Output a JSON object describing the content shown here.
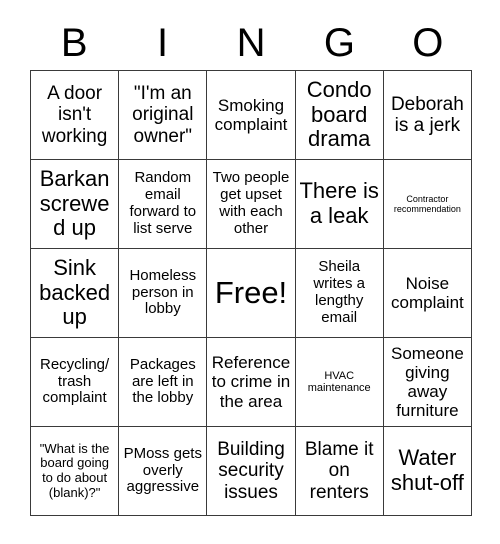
{
  "card": {
    "title": "BINGO",
    "header_letters": [
      "B",
      "I",
      "N",
      "G",
      "O"
    ],
    "free_space_index": 12,
    "colors": {
      "background": "#ffffff",
      "text": "#000000",
      "grid_line": "#3a3a3a"
    }
  },
  "grid": {
    "columns": 5,
    "rows": 5,
    "cells": [
      {
        "text": "A door isn't working",
        "size": "lg"
      },
      {
        "text": "\"I'm an original owner\"",
        "size": "lg"
      },
      {
        "text": "Smoking complaint",
        "size": "md"
      },
      {
        "text": "Condo board drama",
        "size": "xl"
      },
      {
        "text": "Deborah is a jerk",
        "size": "lg"
      },
      {
        "text": "Barkan screwed up",
        "size": "xl"
      },
      {
        "text": "Random email forward to list serve",
        "size": "sm"
      },
      {
        "text": "Two people get upset with each other",
        "size": "sm"
      },
      {
        "text": "There is a leak",
        "size": "xl"
      },
      {
        "text": "Contractor recommendation",
        "size": "tiny"
      },
      {
        "text": "Sink backed up",
        "size": "xl"
      },
      {
        "text": "Homeless person in lobby",
        "size": "sm"
      },
      {
        "text": "Free!",
        "size": "xxl"
      },
      {
        "text": "Sheila writes a lengthy email",
        "size": "sm"
      },
      {
        "text": "Noise complaint",
        "size": "md"
      },
      {
        "text": "Recycling/ trash complaint",
        "size": "sm"
      },
      {
        "text": "Packages are left in the lobby",
        "size": "sm"
      },
      {
        "text": "Reference to crime in the area",
        "size": "md"
      },
      {
        "text": "HVAC maintenance",
        "size": "xxs"
      },
      {
        "text": "Someone giving away furniture",
        "size": "md"
      },
      {
        "text": "\"What is the board going to do about (blank)?\"",
        "size": "xs"
      },
      {
        "text": "PMoss gets overly aggressive",
        "size": "sm"
      },
      {
        "text": "Building security issues",
        "size": "lg"
      },
      {
        "text": "Blame it on renters",
        "size": "lg"
      },
      {
        "text": "Water shut-off",
        "size": "xl"
      }
    ]
  }
}
